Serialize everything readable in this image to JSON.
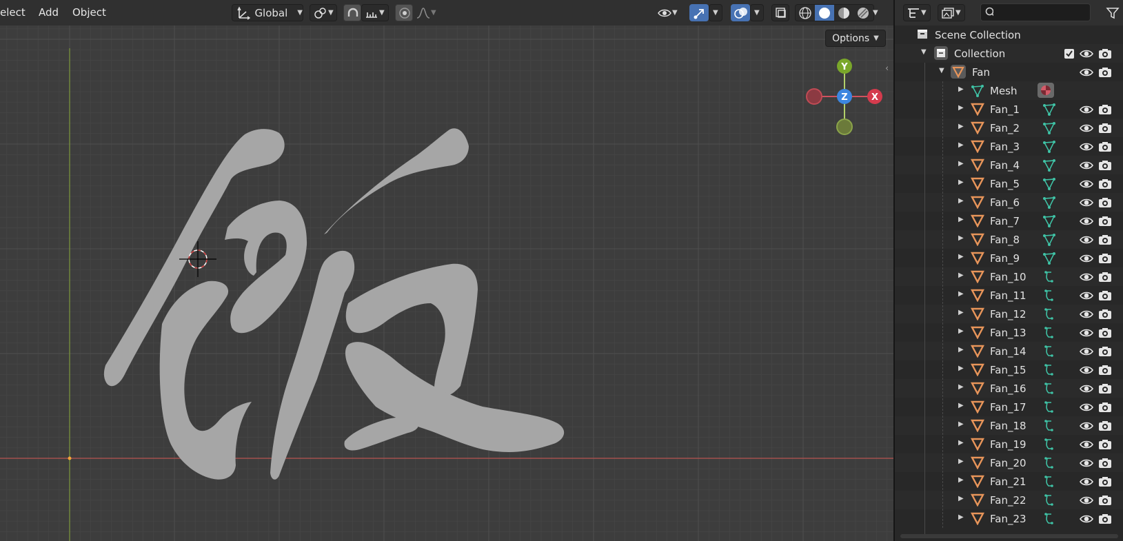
{
  "header": {
    "menu": [
      "elect",
      "Add",
      "Object"
    ],
    "transform_orientation": "Global",
    "options_label": "Options"
  },
  "gizmo": {
    "y": "Y",
    "z": "Z",
    "x": "X"
  },
  "colors": {
    "viewport_bg": "#3d3d3d",
    "grid": "#4a4a4a",
    "x_axis": "#b85451",
    "y_axis": "#7e9a3d",
    "glyph_fill": "#a6a6a6",
    "accent_blue": "#4772b3",
    "object_orange": "#e8955a",
    "mesh_teal": "#3fc3a6"
  },
  "outliner": {
    "search_placeholder": "",
    "scene_collection": "Scene Collection",
    "collection": "Collection",
    "parent": "Fan",
    "mesh": "Mesh",
    "children": [
      {
        "name": "Fan_1",
        "data": "mesh"
      },
      {
        "name": "Fan_2",
        "data": "mesh"
      },
      {
        "name": "Fan_3",
        "data": "mesh"
      },
      {
        "name": "Fan_4",
        "data": "mesh"
      },
      {
        "name": "Fan_5",
        "data": "mesh"
      },
      {
        "name": "Fan_6",
        "data": "mesh"
      },
      {
        "name": "Fan_7",
        "data": "mesh"
      },
      {
        "name": "Fan_8",
        "data": "mesh"
      },
      {
        "name": "Fan_9",
        "data": "mesh"
      },
      {
        "name": "Fan_10",
        "data": "curve"
      },
      {
        "name": "Fan_11",
        "data": "curve"
      },
      {
        "name": "Fan_12",
        "data": "curve"
      },
      {
        "name": "Fan_13",
        "data": "curve"
      },
      {
        "name": "Fan_14",
        "data": "curve"
      },
      {
        "name": "Fan_15",
        "data": "curve"
      },
      {
        "name": "Fan_16",
        "data": "curve"
      },
      {
        "name": "Fan_17",
        "data": "curve"
      },
      {
        "name": "Fan_18",
        "data": "curve"
      },
      {
        "name": "Fan_19",
        "data": "curve"
      },
      {
        "name": "Fan_20",
        "data": "curve"
      },
      {
        "name": "Fan_21",
        "data": "curve"
      },
      {
        "name": "Fan_22",
        "data": "curve"
      },
      {
        "name": "Fan_23",
        "data": "curve"
      }
    ]
  }
}
